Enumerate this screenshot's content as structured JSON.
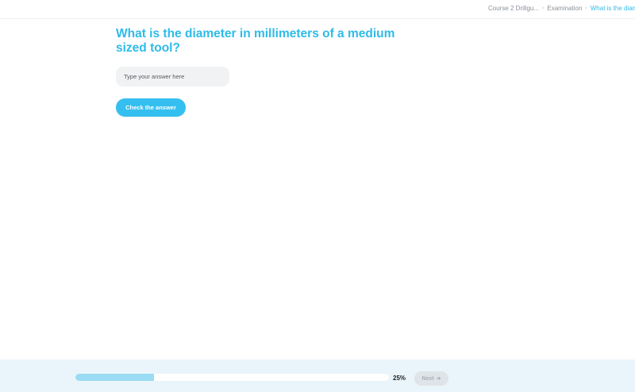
{
  "breadcrumb": {
    "items": [
      "Course 2 Drillgu...",
      "Examination",
      "What is the diame"
    ],
    "separator": "›"
  },
  "question": {
    "text": "What is the diameter in millimeters of a medium sized tool?"
  },
  "answer": {
    "placeholder": "Type your answer here",
    "value": ""
  },
  "check_button": {
    "label": "Check the answer"
  },
  "progress": {
    "fraction": 0.25,
    "label": "25%"
  },
  "next_button": {
    "label": "Next",
    "icon": "arrow-right-icon",
    "enabled": false
  },
  "colors": {
    "accent": "#2ebbe9",
    "button": "#34bff0",
    "progress_fill": "#9adcf3",
    "footer_bg": "#eaf5fb"
  }
}
